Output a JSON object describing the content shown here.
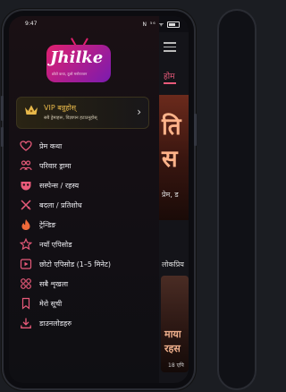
{
  "status_bar": {
    "time": "9:47",
    "indicators": "N ⁵⁶ ᯤ"
  },
  "logo": {
    "wordmark": "Jhilke",
    "tagline": "छोटो कथा, ठूलो मनोरञ्जन"
  },
  "vip": {
    "title": "VIP बन्नुहोस्",
    "subtitle": "सबै ड्रेमाहरू, विज्ञापन हटाउनुहोस्"
  },
  "menu": [
    {
      "label": "प्रेम कथा",
      "icon": "heart-icon"
    },
    {
      "label": "परिवार ड्रामा",
      "icon": "family-icon"
    },
    {
      "label": "सस्पेन्स / रहस्य",
      "icon": "mask-icon"
    },
    {
      "label": "बदला / प्रतिशोध",
      "icon": "swords-icon"
    },
    {
      "label": "ट्रेन्डिङ",
      "icon": "flame-icon"
    },
    {
      "label": "नयाँ एपिसोड",
      "icon": "star-icon"
    },
    {
      "label": "छोटो एपिसोड (1–5 मिनेट)",
      "icon": "play-icon"
    },
    {
      "label": "सबै शृखला",
      "icon": "grid-icon"
    },
    {
      "label": "मेरो सूची",
      "icon": "bookmark-icon"
    },
    {
      "label": "डाउनलोडहरु",
      "icon": "download-icon"
    }
  ],
  "background_app": {
    "tab": "होम",
    "banner_line1": "ति",
    "banner_line2": "स",
    "banner_caption": "प्रेम, ड",
    "section_title": "लोकप्रिय",
    "card_line1": "माया",
    "card_line2": "रहस",
    "card_caption": "18 एपि"
  },
  "colors": {
    "accent": "#e85a7a",
    "vip_gold": "#e7b84a",
    "brand_pink": "#e0206e",
    "brand_purple": "#7a1bb0"
  }
}
